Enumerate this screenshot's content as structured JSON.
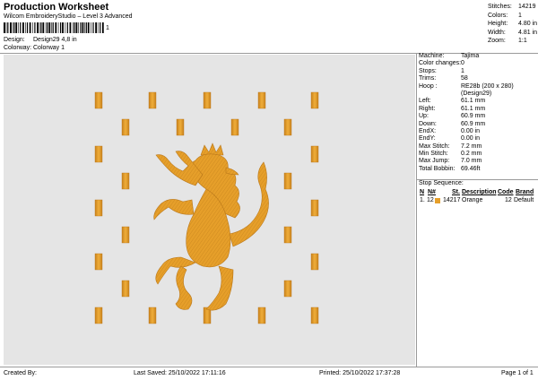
{
  "header": {
    "title": "Production Worksheet",
    "subtitle": "Wilcom EmbroideryStudio – Level 3 Advanced",
    "barcode_suffix": "1"
  },
  "design_info": [
    {
      "label": "Design:",
      "value": "Design29 4,8 in"
    },
    {
      "label": "Colorway:",
      "value": "Colorway 1"
    }
  ],
  "stats": [
    {
      "label": "Stitches:",
      "value": "14219"
    },
    {
      "label": "Colors:",
      "value": "1"
    },
    {
      "label": "Height:",
      "value": "4.80 in"
    },
    {
      "label": "Width:",
      "value": "4.81 in"
    },
    {
      "label": "Zoom:",
      "value": "1:1"
    }
  ],
  "details": [
    {
      "label": "Machine:",
      "value": "Tajima"
    },
    {
      "label": "Color changes:",
      "value": "0"
    },
    {
      "label": "Stops:",
      "value": "1"
    },
    {
      "label": "Trims:",
      "value": "58"
    },
    {
      "label": "Hoop :",
      "value": "RE28b (200 x 280)"
    },
    {
      "label": "",
      "value": "(Design29)"
    },
    {
      "label": "Left:",
      "value": "61.1 mm"
    },
    {
      "label": "Right:",
      "value": "61.1 mm"
    },
    {
      "label": "Up:",
      "value": "60.9 mm"
    },
    {
      "label": "Down:",
      "value": "60.9 mm"
    },
    {
      "label": "EndX:",
      "value": "0.00 in"
    },
    {
      "label": "EndY:",
      "value": "0.00 in"
    },
    {
      "label": "Max Stitch:",
      "value": "7.2 mm"
    },
    {
      "label": "Min Stitch:",
      "value": "0.2 mm"
    },
    {
      "label": "Max Jump:",
      "value": "7.0 mm"
    },
    {
      "label": "Total Bobbin:",
      "value": "69.46ft"
    }
  ],
  "stop_sequence": {
    "title": "Stop Sequence:",
    "headers": {
      "n": "N",
      "num": "N#",
      "st": "St.",
      "description": "Description",
      "code": "Code",
      "brand": "Brand"
    },
    "rows": [
      {
        "n": "1.",
        "num": "12",
        "st": "14217",
        "description": "Orange",
        "code": "12",
        "brand": "Default",
        "color": "#e69f2a"
      }
    ]
  },
  "footer": {
    "created_by": "Created By:",
    "last_saved": "Last Saved: 25/10/2022 17:11:16",
    "printed": "Printed: 25/10/2022 17:37:28",
    "page": "Page 1 of 1"
  },
  "colors": {
    "thread": "#e69f2a",
    "thread_dark": "#b9771a",
    "canvas": "#e5e5e5"
  }
}
